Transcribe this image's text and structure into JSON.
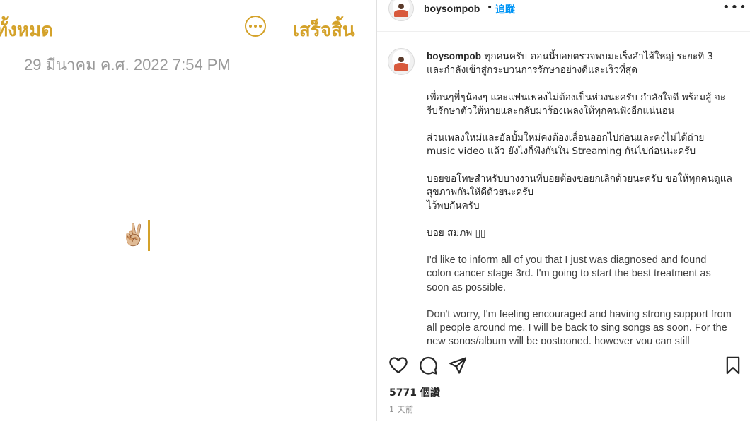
{
  "notes": {
    "back_label": "ทั้งหมด",
    "done_label": "เสร็จสิ้น",
    "date": "29 มีนาคม ค.ศ. 2022 7:54 PM",
    "content": "✌🏼"
  },
  "post": {
    "username": "boysompob",
    "separator": "•",
    "follow_label": "追蹤",
    "options": "•••",
    "caption": {
      "username": "boysompob",
      "paragraphs": [
        "ทุกคนครับ ตอนนี้บอยตรวจพบมะเร็งลำไส้ใหญ่ ระยะที่ 3 และกำลังเข้าสู่กระบวนการรักษาอย่างดีและเร็วที่สุด",
        "เพื่อนๆพี่ๆน้องๆ และแฟนเพลงไม่ต้องเป็นห่วงนะครับ กำลังใจดี พร้อมสู้ จะรีบรักษาตัวให้หายและกลับมาร้องเพลงให้ทุกคนฟังอีกแน่นอน",
        "ส่วนเพลงใหม่และอัลบั้มใหม่คงต้องเลื่อนออกไปก่อนและคงไม่ได้ถ่าย music video แล้ว ยังไงก็ฟังกันใน Streaming กันไปก่อนนะครับ",
        "บอยขอโทษสำหรับบางงานที่บอยต้องขอยกเลิกด้วยนะครับ ขอให้ทุกคนดูแลสุขภาพกันให้ดีด้วยนะครับ\nไว้พบกันครับ",
        "บอย สมภพ ▯▯",
        "I'd like to inform all of you that I just was diagnosed and found colon cancer stage 3rd. I'm going to start the best treatment as soon as possible.",
        "Don't worry, I'm feeling encouraged and having strong support from all people around me. I will be back to sing songs as soon. For the new songs/album will be postponed, however you can still"
      ]
    },
    "likes": "5771 個讚",
    "age": "1 天前"
  },
  "colors": {
    "notes_accent": "#d4a22a",
    "link_blue": "#0095f6",
    "text": "#262626"
  },
  "icons": [
    "more-circle-icon",
    "heart-icon",
    "comment-icon",
    "share-icon",
    "bookmark-icon"
  ]
}
